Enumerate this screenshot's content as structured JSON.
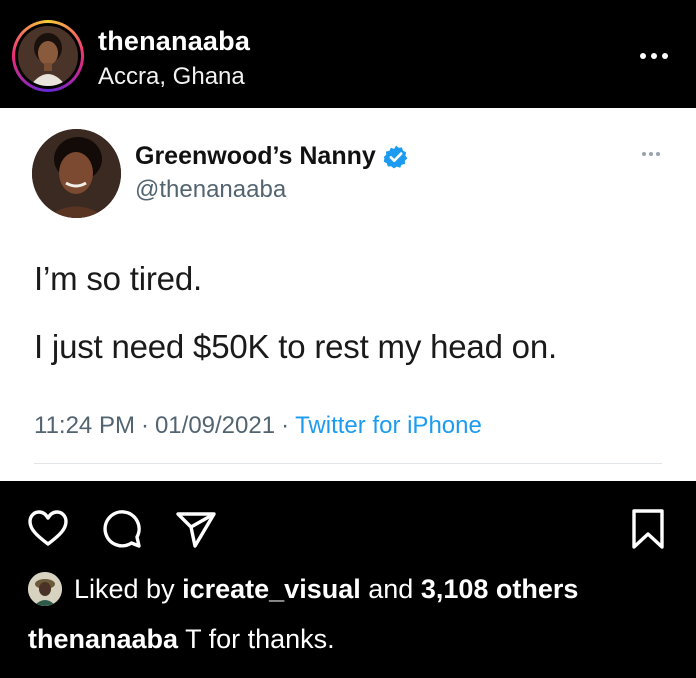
{
  "post_header": {
    "username": "thenanaaba",
    "location": "Accra, Ghana",
    "more_icon": "more-horizontal-icon"
  },
  "tweet": {
    "display_name": "Greenwood’s Nanny",
    "handle": "@thenanaaba",
    "verified": true,
    "line1": "I’m so tired.",
    "line2": "I just need $50K to rest my head on.",
    "time": "11:24 PM",
    "sep1": "·",
    "date": "01/09/2021",
    "sep2": "·",
    "source": "Twitter for iPhone",
    "colors": {
      "link": "#1d9bf0",
      "verified": "#1d9bf0",
      "muted": "#536471"
    }
  },
  "actions": {
    "like_icon": "heart-icon",
    "comment_icon": "comment-icon",
    "share_icon": "send-icon",
    "save_icon": "bookmark-icon"
  },
  "likes": {
    "prefix": "Liked by",
    "user": "icreate_visual",
    "middle": "and",
    "count": "3,108 others"
  },
  "caption": {
    "user": "thenanaaba",
    "text": "T for thanks."
  }
}
